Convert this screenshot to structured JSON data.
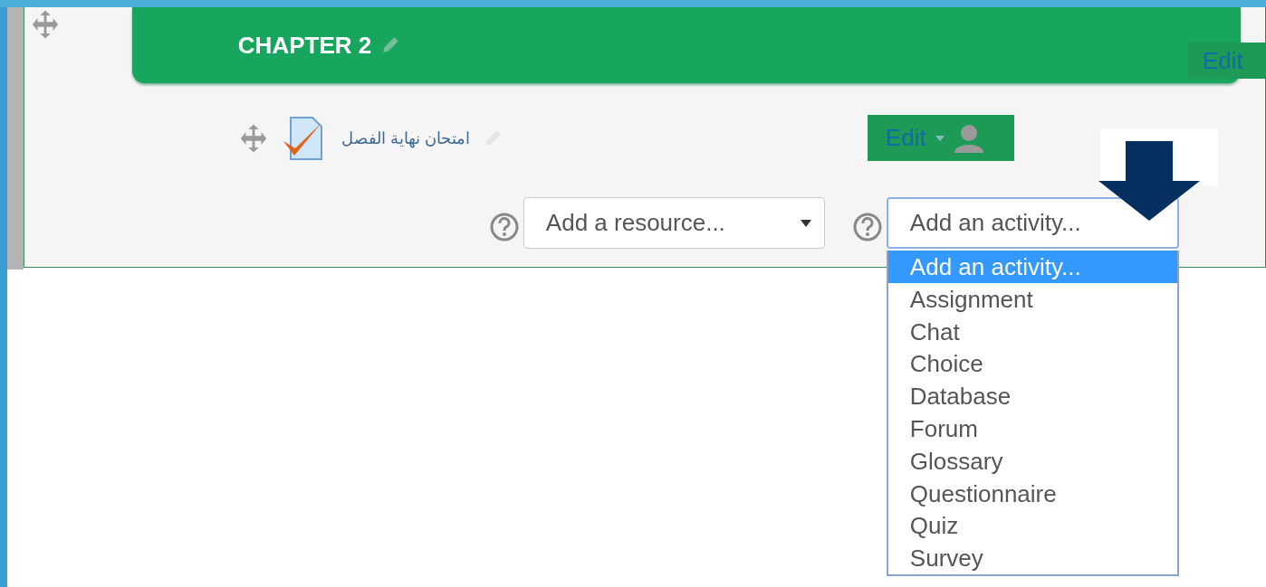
{
  "section": {
    "title": "CHAPTER 2",
    "edit_label": "Edit"
  },
  "activity": {
    "name": "امتحان نهاية الفصل",
    "edit_label": "Edit"
  },
  "resource_select": {
    "value": "Add a resource..."
  },
  "activity_select": {
    "value": "Add an activity...",
    "expanded": true,
    "options": [
      {
        "label": "Add an activity...",
        "selected": true
      },
      {
        "label": "Assignment",
        "selected": false
      },
      {
        "label": "Chat",
        "selected": false
      },
      {
        "label": "Choice",
        "selected": false
      },
      {
        "label": "Database",
        "selected": false
      },
      {
        "label": "Forum",
        "selected": false
      },
      {
        "label": "Glossary",
        "selected": false
      },
      {
        "label": "Questionnaire",
        "selected": false
      },
      {
        "label": "Quiz",
        "selected": false
      },
      {
        "label": "Survey",
        "selected": false
      }
    ]
  }
}
